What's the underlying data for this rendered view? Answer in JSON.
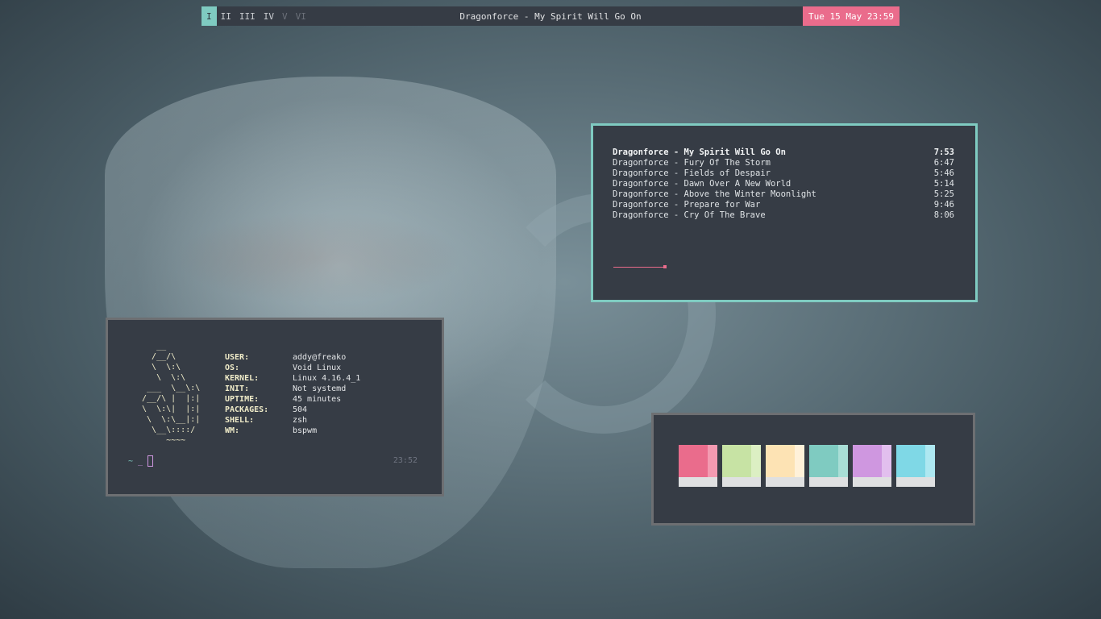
{
  "topbar": {
    "workspaces": [
      {
        "label": "I",
        "state": "active"
      },
      {
        "label": "II",
        "state": "occupied"
      },
      {
        "label": "III",
        "state": "occupied"
      },
      {
        "label": "IV",
        "state": "occupied"
      },
      {
        "label": "V",
        "state": "empty"
      },
      {
        "label": "VI",
        "state": "empty"
      }
    ],
    "title": "Dragonforce - My Spirit Will Go On",
    "datetime": "Tue 15 May 23:59"
  },
  "player": {
    "tracks": [
      {
        "title": "Dragonforce - My Spirit Will Go On",
        "length": "7:53"
      },
      {
        "title": "Dragonforce - Fury Of The Storm",
        "length": "6:47"
      },
      {
        "title": "Dragonforce - Fields of Despair",
        "length": "5:46"
      },
      {
        "title": "Dragonforce - Dawn Over A New World",
        "length": "5:14"
      },
      {
        "title": "Dragonforce - Above the Winter Moonlight",
        "length": "5:25"
      },
      {
        "title": "Dragonforce - Prepare for War",
        "length": "9:46"
      },
      {
        "title": "Dragonforce - Cry Of The Brave",
        "length": "8:06"
      }
    ],
    "current_index": 0,
    "progress_fraction": 0.15
  },
  "terminal": {
    "ascii_logo": "    __\n   /__/\\\n   \\  \\:\\\n    \\  \\:\\\n  ___  \\__\\:\\\n /__/\\ |  |:|\n \\  \\:\\|  |:|\n  \\  \\:\\__|:|\n   \\__\\::::/\n      ~~~~",
    "info": [
      {
        "key": "USER:",
        "value": "addy@freako"
      },
      {
        "key": "OS:",
        "value": "Void Linux"
      },
      {
        "key": "KERNEL:",
        "value": "Linux 4.16.4_1"
      },
      {
        "key": "INIT:",
        "value": "Not systemd"
      },
      {
        "key": "UPTIME:",
        "value": "45 minutes"
      },
      {
        "key": "PACKAGES:",
        "value": "504"
      },
      {
        "key": "SHELL:",
        "value": "zsh"
      },
      {
        "key": "WM:",
        "value": "bspwm"
      }
    ],
    "prompt_symbol": "~",
    "prompt_arrow": "_",
    "time": "23:52"
  },
  "palette": {
    "swatches": [
      {
        "name": "pink",
        "main": "#ea6c8c",
        "side": "#f39ab1"
      },
      {
        "name": "green",
        "main": "#c7e3a4",
        "side": "#dcefc3"
      },
      {
        "name": "peach",
        "main": "#fde3b4",
        "side": "#fff1d9"
      },
      {
        "name": "teal",
        "main": "#7fcbc1",
        "side": "#a9ded6"
      },
      {
        "name": "purple",
        "main": "#cf97e0",
        "side": "#e2bfee"
      },
      {
        "name": "cyan",
        "main": "#7fd8e6",
        "side": "#aee8f1"
      }
    ]
  },
  "colors": {
    "accent": "#7fcbc1",
    "highlight": "#ea6c8c",
    "panel_bg": "#363c45"
  }
}
